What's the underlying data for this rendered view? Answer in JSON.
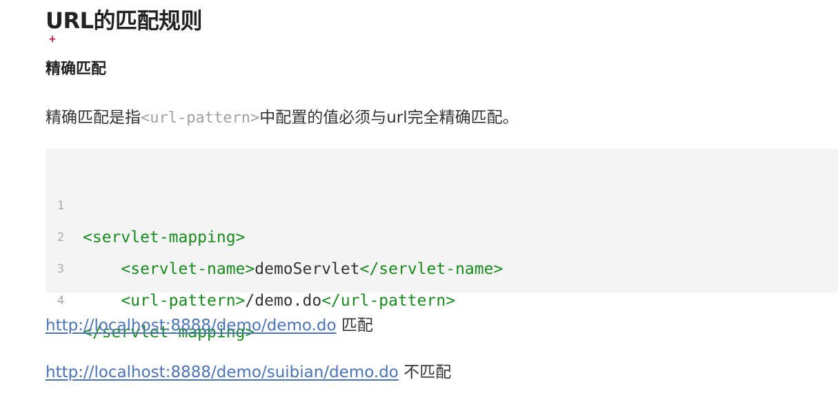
{
  "heading": "URL的匹配规则",
  "cursor_glyph": "+",
  "subheading": "精确匹配",
  "paragraph": {
    "before": "精确匹配是指",
    "code": "<url-pattern>",
    "after": "中配置的值必须与url完全精确匹配。"
  },
  "code_block": {
    "lines": [
      {
        "number": "1",
        "indent": "",
        "open_tag": "<servlet-mapping>",
        "text": "",
        "close_tag": ""
      },
      {
        "number": "2",
        "indent": "    ",
        "open_tag": "<servlet-name>",
        "text": "demoServlet",
        "close_tag": "</servlet-name>"
      },
      {
        "number": "3",
        "indent": "    ",
        "open_tag": "<url-pattern>",
        "text": "/demo.do",
        "close_tag": "</url-pattern>"
      },
      {
        "number": "4",
        "indent": "",
        "open_tag": "</servlet-mapping>",
        "text": "",
        "close_tag": ""
      }
    ]
  },
  "examples": [
    {
      "url": "http://localhost:8888/demo/demo.do",
      "result": "匹配"
    },
    {
      "url": "http://localhost:8888/demo/suibian/demo.do",
      "result": "不匹配"
    }
  ],
  "colors": {
    "tag": "#188a1e",
    "link": "#4a73b8",
    "inline_code": "#a0a0a0",
    "code_bg": "#f4f4f4"
  }
}
